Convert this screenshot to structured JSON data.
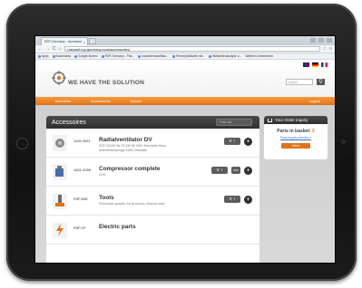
{
  "browser": {
    "tab_title": "R2P-Germany :: Accessori...",
    "tab_close": "×",
    "url": "r-t-nat-r-p-germany.com/accessories/",
    "url_display": "r-tstanel.rcp-germany.com/accessories/",
    "back_glyph": "←",
    "forward_glyph": "→",
    "reload_glyph": "C",
    "home_glyph": "⌂",
    "star_glyph": "☆",
    "menu_glyph": "≡",
    "bookmarks": [
      "Apps",
      "Bookmarks",
      "Google Ibortex",
      "R2P-Germany - Pas...",
      "Industriemodelltau...",
      "Firmenjubiläumk mit...",
      "Webseitenanalyse u...",
      "Weitere Lesezeichen"
    ]
  },
  "site": {
    "slogan": "WE HAVE THE SOLUTION",
    "search_placeholder": "search",
    "search_button": "Q",
    "languages": [
      "en",
      "de",
      "fr"
    ],
    "nav": [
      "Machines",
      "Accessories",
      "Docket"
    ],
    "login": "Logout"
  },
  "accessories": {
    "title": "Accessoires",
    "filter_placeholder": "Filter list",
    "items": [
      {
        "code": "1105.0001",
        "name": "Radialventilator DV",
        "desc": "VR2 200/40 5a 23.230 für NMV Mercedes Benz Antriebsfahrzeuge 240B Zeitstätte",
        "has_pdf": false
      },
      {
        "code": "1601-2006",
        "name": "Compressor complete",
        "desc": "CHS",
        "has_pdf": true
      },
      {
        "code": "R3P-BW",
        "name": "Tools",
        "desc": "Pneumatic spades, Air jet lances, Manual tools",
        "has_pdf": false
      },
      {
        "code": "R3P-5T",
        "name": "Electric parts",
        "desc": "",
        "has_pdf": false
      }
    ],
    "pdf_label": "PDF",
    "list_glyph": "≡",
    "arrow_glyph": "›",
    "add_glyph": "+"
  },
  "order": {
    "title": "Your Order inquiry",
    "basket_label": "Parts in basket:",
    "basket_count": "3",
    "show_link": "Show inquiry overview »",
    "send_button": "Send"
  }
}
